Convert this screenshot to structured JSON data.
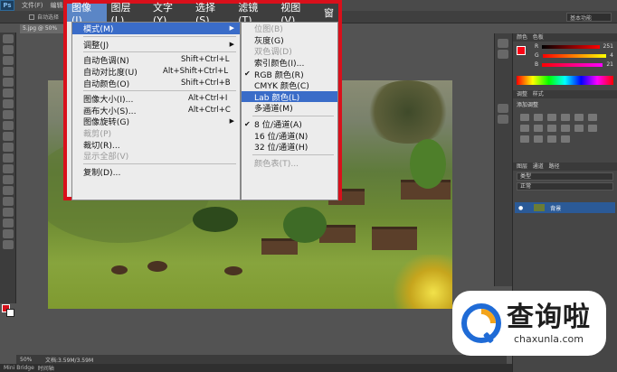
{
  "app": {
    "logo": "Ps",
    "menu_items": [
      "文件(F)",
      "编辑"
    ],
    "options_text": "自动选择",
    "doc_tab": "5.jpg @ 50%",
    "workspace": "基本功能",
    "zoom": "50%",
    "doc_info": "文档:3.59M/3.59M",
    "bottom_tabs": [
      "Mini Bridge",
      "时间轴"
    ]
  },
  "menubar": {
    "items": [
      "图像(I)",
      "图层(L)",
      "文字(Y)",
      "选择(S)",
      "滤镜(T)",
      "视图(V)",
      "窗"
    ]
  },
  "image_menu": {
    "items": [
      {
        "label": "模式(M)",
        "shortcut": "",
        "submenu": true,
        "highlighted": true
      },
      {
        "label": "调整(J)",
        "shortcut": "",
        "submenu": true
      },
      {
        "label": "自动色调(N)",
        "shortcut": "Shift+Ctrl+L"
      },
      {
        "label": "自动对比度(U)",
        "shortcut": "Alt+Shift+Ctrl+L"
      },
      {
        "label": "自动颜色(O)",
        "shortcut": "Shift+Ctrl+B"
      },
      {
        "label": "图像大小(I)...",
        "shortcut": "Alt+Ctrl+I"
      },
      {
        "label": "画布大小(S)...",
        "shortcut": "Alt+Ctrl+C"
      },
      {
        "label": "图像旋转(G)",
        "shortcut": "",
        "submenu": true
      },
      {
        "label": "裁剪(P)",
        "shortcut": "",
        "disabled": true
      },
      {
        "label": "裁切(R)...",
        "shortcut": ""
      },
      {
        "label": "显示全部(V)",
        "shortcut": "",
        "disabled": true
      },
      {
        "label": "复制(D)...",
        "shortcut": ""
      }
    ]
  },
  "mode_menu": {
    "items": [
      {
        "label": "位图(B)",
        "disabled": true
      },
      {
        "label": "灰度(G)"
      },
      {
        "label": "双色调(D)",
        "disabled": true
      },
      {
        "label": "索引颜色(I)..."
      },
      {
        "label": "RGB 颜色(R)",
        "checked": true
      },
      {
        "label": "CMYK 颜色(C)"
      },
      {
        "label": "Lab 颜色(L)",
        "highlighted": true
      },
      {
        "label": "多通道(M)"
      },
      {
        "label": "8 位/通道(A)",
        "checked": true
      },
      {
        "label": "16 位/通道(N)"
      },
      {
        "label": "32 位/通道(H)"
      },
      {
        "label": "颜色表(T)...",
        "disabled": true
      }
    ]
  },
  "panels": {
    "color_tab": "颜色",
    "swatches_tab": "色板",
    "r_label": "R",
    "r_value": "251",
    "g_label": "G",
    "g_value": "4",
    "b_label": "B",
    "b_value": "21",
    "adjust_tab": "调整",
    "styles_tab": "样式",
    "adjust_title": "添加调整",
    "layers_tab": "图层",
    "channels_tab": "通道",
    "paths_tab": "路径",
    "kind_label": "类型",
    "blend_mode": "正常",
    "layer_name": "背景",
    "fg_color": "#fb0415"
  },
  "watermark": {
    "cn": "查询啦",
    "en": "chaxunla.com",
    "accent": "#1f6bd6",
    "accent2": "#f3a41c"
  }
}
